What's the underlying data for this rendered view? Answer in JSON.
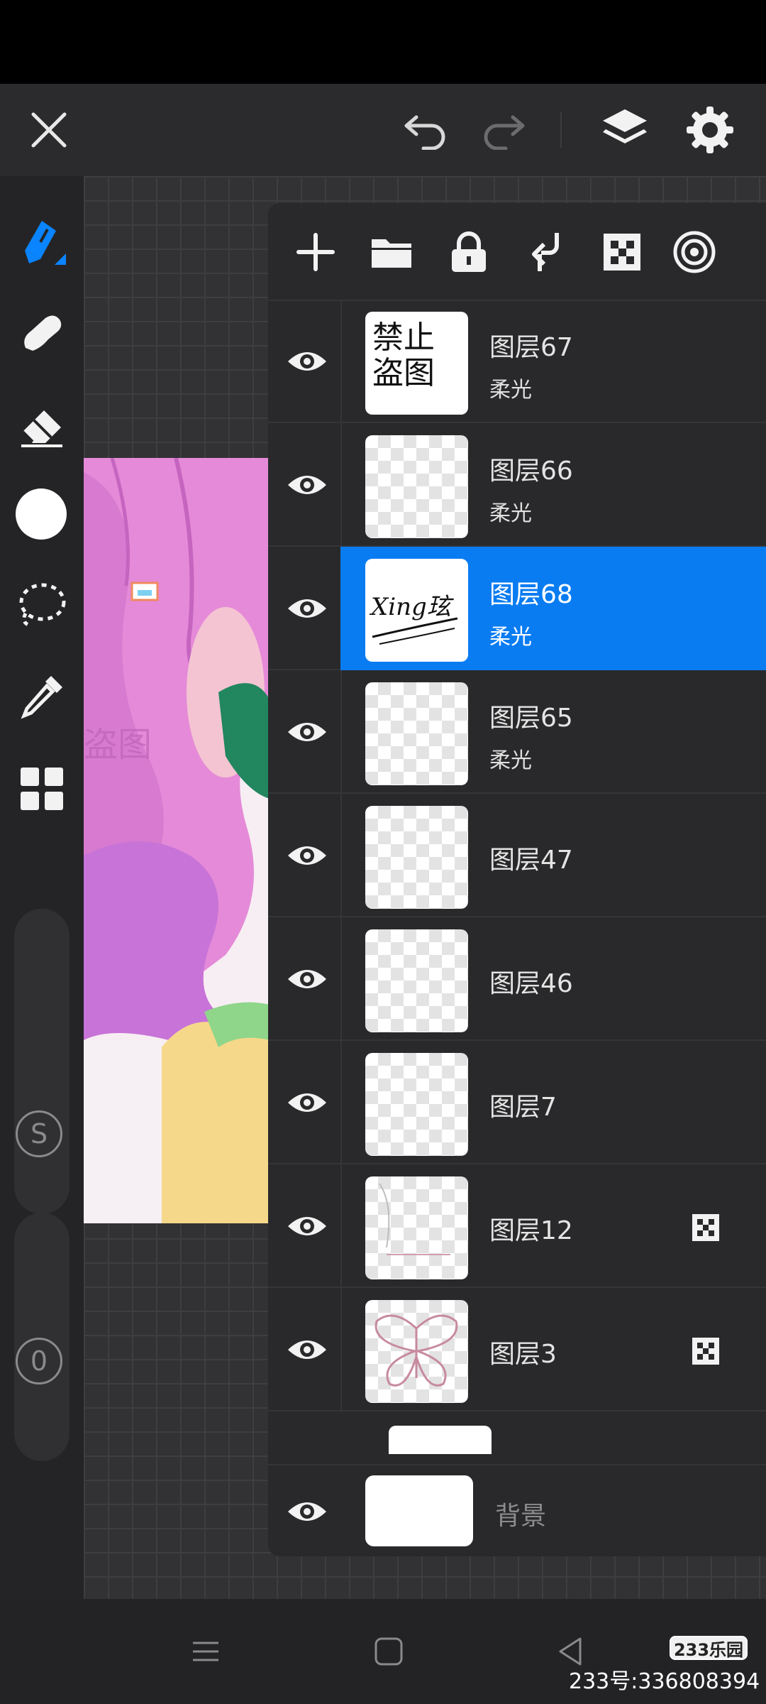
{
  "topbar": {
    "icons": [
      "close-icon",
      "undo-icon",
      "redo-icon",
      "layers-icon",
      "settings-icon"
    ]
  },
  "toolbar": {
    "tools": [
      "brush-icon",
      "smudge-icon",
      "eraser-icon",
      "color-swatch",
      "lasso-icon",
      "eyedropper-icon",
      "grid-icon"
    ],
    "active_tool": "brush-icon",
    "active_color": "#0a84ff",
    "current_color": "#ffffff",
    "size_label": "S",
    "opacity_label": "0"
  },
  "layers_toolbar": {
    "icons": [
      "add-layer-icon",
      "folder-icon",
      "lock-icon",
      "clip-icon",
      "alpha-lock-icon",
      "blend-icon"
    ]
  },
  "layers": [
    {
      "name": "图层67",
      "blend": "柔光",
      "thumb": "watermark-禁止盗图",
      "selected": false,
      "alpha_lock": false
    },
    {
      "name": "图层66",
      "blend": "柔光",
      "thumb": "transparent",
      "selected": false,
      "alpha_lock": false
    },
    {
      "name": "图层68",
      "blend": "柔光",
      "thumb": "signature",
      "selected": true,
      "alpha_lock": false
    },
    {
      "name": "图层65",
      "blend": "柔光",
      "thumb": "transparent",
      "selected": false,
      "alpha_lock": false
    },
    {
      "name": "图层47",
      "blend": "",
      "thumb": "transparent",
      "selected": false,
      "alpha_lock": false
    },
    {
      "name": "图层46",
      "blend": "",
      "thumb": "transparent",
      "selected": false,
      "alpha_lock": false
    },
    {
      "name": "图层7",
      "blend": "",
      "thumb": "transparent",
      "selected": false,
      "alpha_lock": false
    },
    {
      "name": "图层12",
      "blend": "",
      "thumb": "sketch",
      "selected": false,
      "alpha_lock": true
    },
    {
      "name": "图层3",
      "blend": "",
      "thumb": "butterfly",
      "selected": false,
      "alpha_lock": true
    }
  ],
  "background_layer": {
    "name": "背景"
  },
  "thumb_text": {
    "watermark": "禁止盗图",
    "signature": "Xing玹"
  },
  "navbar": {
    "icons": [
      "menu-nav-icon",
      "home-nav-icon",
      "back-nav-icon"
    ]
  },
  "watermark": {
    "badge": "233乐园",
    "text": "233号:336808394"
  },
  "colors": {
    "accent": "#0a7cf2",
    "panel": "#29292b",
    "background": "#2e2e30"
  }
}
